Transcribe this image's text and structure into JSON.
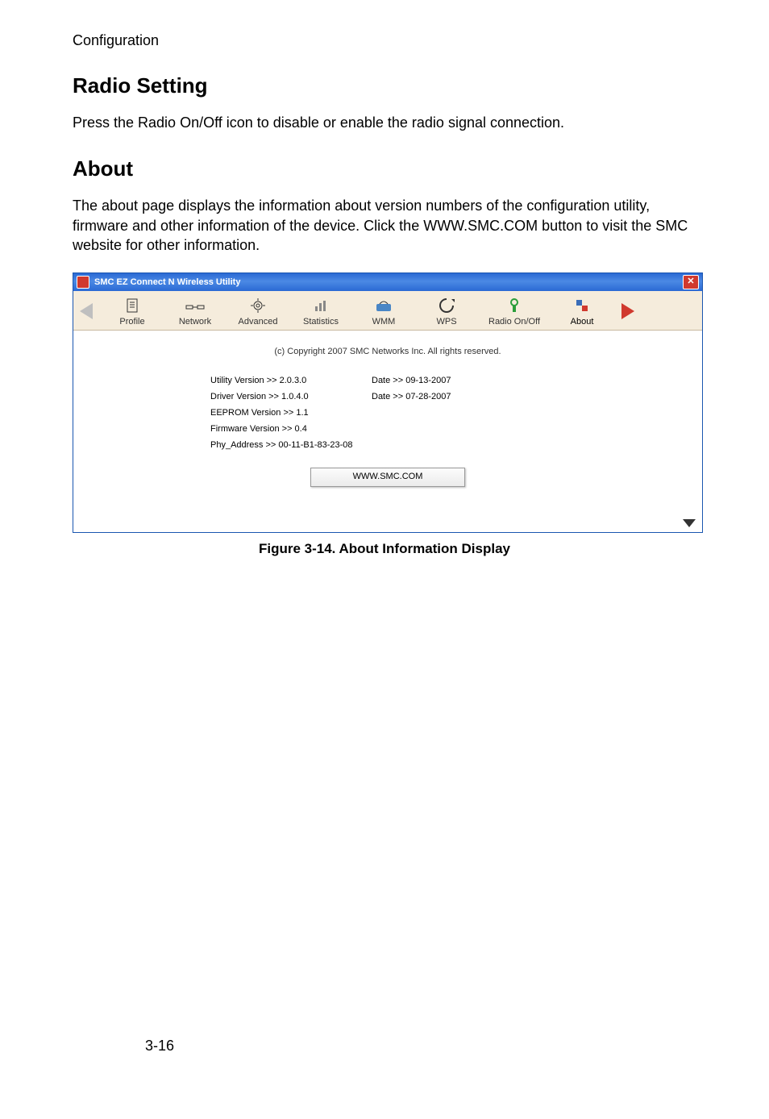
{
  "running_head": "Configuration",
  "section1": {
    "heading": "Radio Setting",
    "para": "Press the Radio On/Off icon to disable or enable the radio signal connection."
  },
  "section2": {
    "heading": "About",
    "para": "The about page displays the information about version numbers of the configuration utility, firmware and other information of the device. Click the WWW.SMC.COM button to visit the SMC website for other information."
  },
  "app": {
    "title": "SMC EZ Connect N Wireless Utility",
    "tabs": {
      "profile": "Profile",
      "network": "Network",
      "advanced": "Advanced",
      "statistics": "Statistics",
      "wmm": "WMM",
      "wps": "WPS",
      "radio": "Radio On/Off",
      "about": "About"
    },
    "content": {
      "copyright": "(c) Copyright 2007 SMC Networks Inc.  All rights reserved.",
      "rows": [
        {
          "label": "Utility Version >>  2.0.3.0",
          "date": "Date >> 09-13-2007"
        },
        {
          "label": "Driver Version >>  1.0.4.0",
          "date": "Date >> 07-28-2007"
        },
        {
          "label": "EEPROM Version >>  1.1",
          "date": ""
        },
        {
          "label": "Firmware Version >>  0.4",
          "date": ""
        },
        {
          "label": "Phy_Address >>  00-11-B1-83-23-08",
          "date": ""
        }
      ],
      "button": "WWW.SMC.COM"
    }
  },
  "caption": "Figure 3-14.  About Information Display",
  "page_number": "3-16"
}
